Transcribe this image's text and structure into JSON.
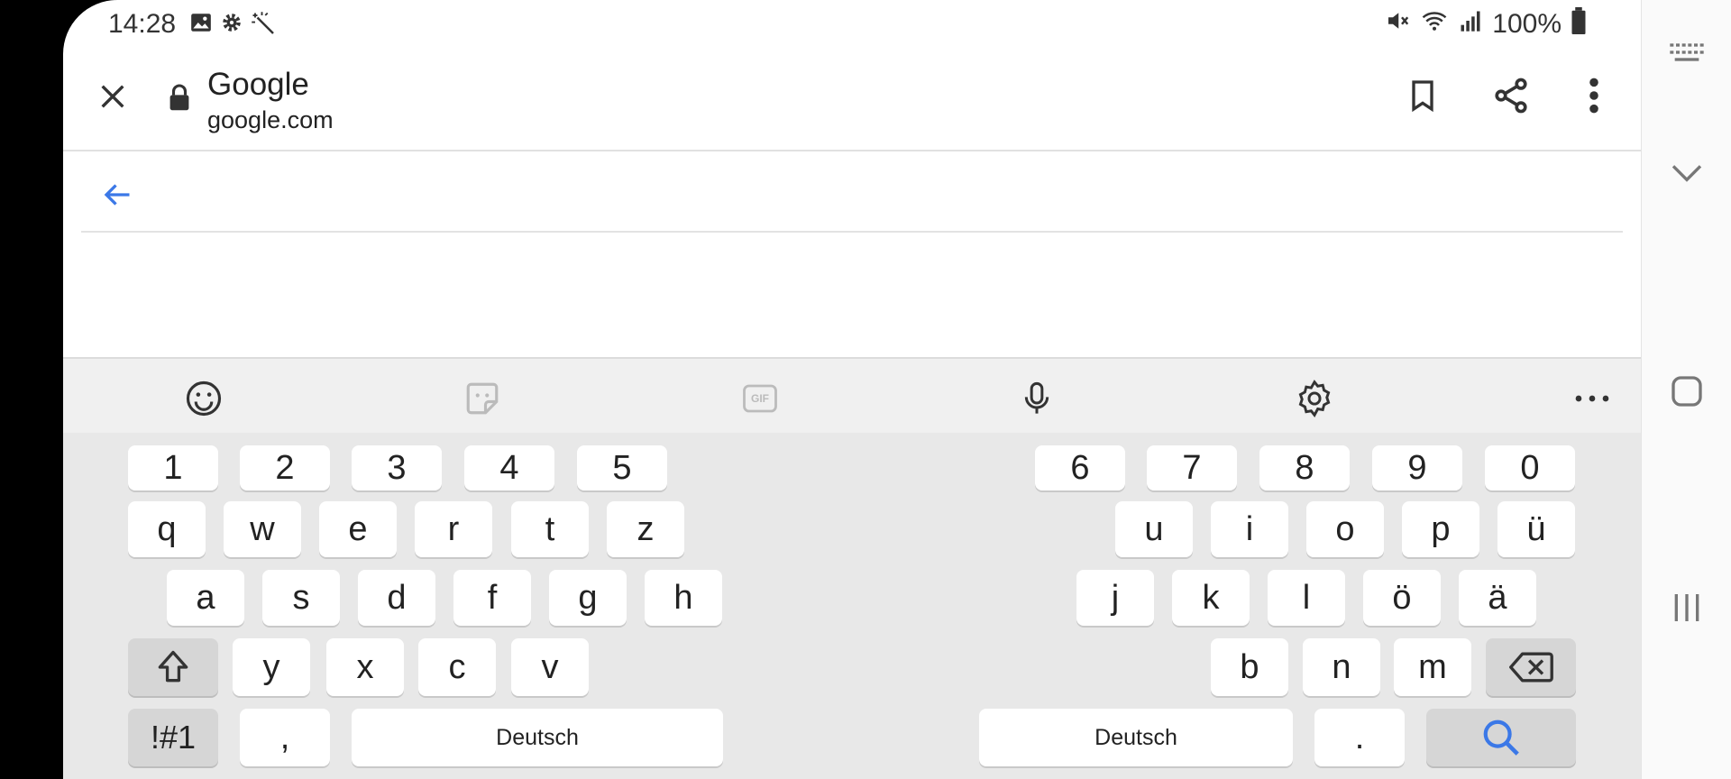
{
  "status_bar": {
    "time": "14:28",
    "battery_percent": "100%",
    "left_icons": [
      "image-icon",
      "settings-icon",
      "magic-wand-icon"
    ],
    "right_icons": [
      "mute-icon",
      "wifi-icon",
      "signal-icon",
      "battery-icon"
    ]
  },
  "toolbar": {
    "page_title": "Google",
    "page_url": "google.com",
    "close_icon": "close-icon",
    "lock_icon": "lock-icon",
    "actions": [
      "bookmark-icon",
      "share-icon",
      "more-vert-icon"
    ]
  },
  "content": {
    "back_icon": "arrow-back-icon",
    "accent_color": "#3b78e7"
  },
  "keyboard": {
    "toolbar_icons": [
      "emoji-icon",
      "sticker-icon",
      "gif-icon",
      "mic-icon",
      "settings-icon",
      "more-horiz-icon"
    ],
    "gif_label": "GIF",
    "left": {
      "row_numbers": [
        "1",
        "2",
        "3",
        "4",
        "5"
      ],
      "row1": [
        "q",
        "w",
        "e",
        "r",
        "t",
        "z"
      ],
      "row2": [
        "a",
        "s",
        "d",
        "f",
        "g",
        "h"
      ],
      "row3": [
        "y",
        "x",
        "c",
        "v"
      ],
      "row4": {
        "symbols": "!#1",
        "comma": ",",
        "space": "Deutsch"
      }
    },
    "right": {
      "row_numbers": [
        "6",
        "7",
        "8",
        "9",
        "0"
      ],
      "row1": [
        "u",
        "i",
        "o",
        "p",
        "ü"
      ],
      "row2": [
        "j",
        "k",
        "l",
        "ö",
        "ä"
      ],
      "row3": [
        "b",
        "n",
        "m"
      ],
      "row4": {
        "space": "Deutsch",
        "period": "."
      }
    }
  },
  "nav_bar": {
    "icons": [
      "keyboard-switch-icon",
      "hide-keyboard-icon",
      "home-icon",
      "recents-icon"
    ]
  }
}
